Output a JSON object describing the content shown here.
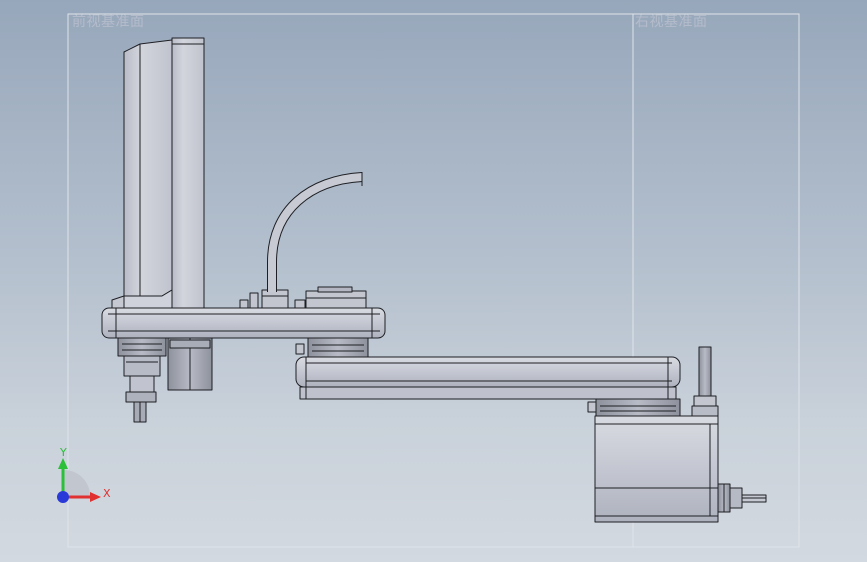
{
  "planes": {
    "front_label": "前视基准面",
    "right_label": "右视基准面"
  },
  "triad": {
    "x_label": "X",
    "y_label": "Y",
    "x_color": "#e03030",
    "y_color": "#2bbf3a",
    "z_color": "#2a3ad8"
  },
  "colors": {
    "background_top": "#97a7bb",
    "background_bottom": "#d3d9e0",
    "part_fill": "#c9ccd5",
    "part_edge": "#1e1f24",
    "plane_border": "#dfe4ea"
  }
}
